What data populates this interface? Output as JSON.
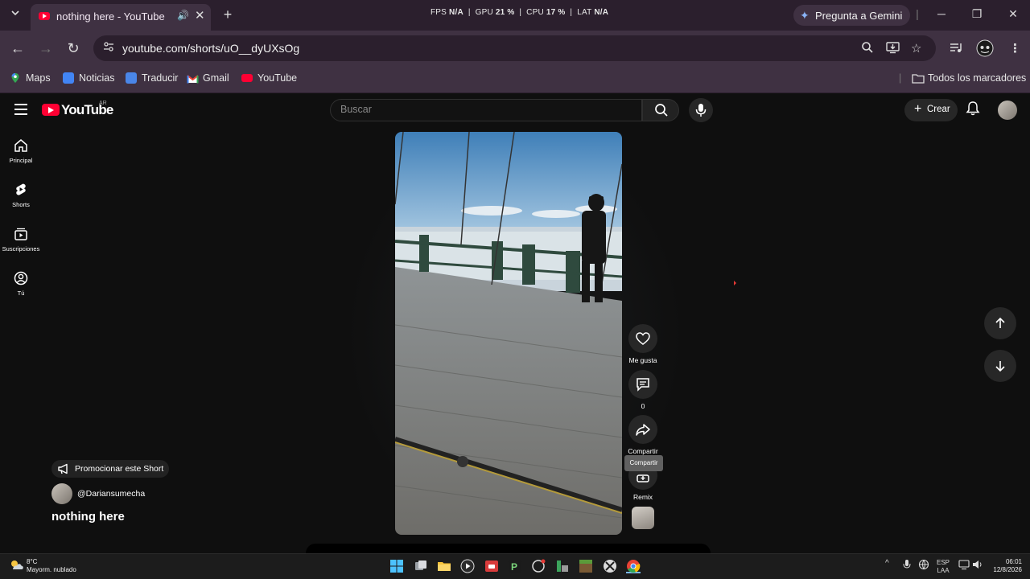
{
  "browser": {
    "tab": {
      "title": "nothing here - YouTube"
    },
    "perf": {
      "fps_label": "FPS",
      "fps": "N/A",
      "gpu_label": "GPU",
      "gpu": "21 %",
      "cpu_label": "CPU",
      "cpu": "17 %",
      "lat_label": "LAT",
      "lat": "N/A"
    },
    "gemini_label": "Pregunta a Gemini",
    "url": "youtube.com/shorts/uO__dyUXsOg",
    "bookmarks": [
      "Maps",
      "Noticias",
      "Traducir",
      "Gmail",
      "YouTube"
    ],
    "all_bookmarks_label": "Todos los marcadores"
  },
  "youtube": {
    "logo_text": "YouTube",
    "country_code": "AR",
    "search_placeholder": "Buscar",
    "create_label": "Crear",
    "rail": [
      {
        "label": "Principal",
        "icon": "home-icon"
      },
      {
        "label": "Shorts",
        "icon": "shorts-icon"
      },
      {
        "label": "Suscripciones",
        "icon": "subscriptions-icon"
      },
      {
        "label": "Tú",
        "icon": "you-icon"
      }
    ],
    "actions": {
      "like_label": "Me gusta",
      "comments_count": "0",
      "share_label": "Compartir",
      "share_tooltip": "Compartir",
      "remix_label": "Remix"
    },
    "promote_label": "Promocionar este Short",
    "channel": "@Dariansumecha",
    "title": "nothing here"
  },
  "taskbar": {
    "weather_temp": "8°C",
    "weather_desc": "Mayorm. nublado",
    "lang_line1": "ESP",
    "lang_line2": "LAA",
    "time": "06:01",
    "date": "12/8/2026"
  },
  "colors": {
    "browser_frame": "#3f3142",
    "tab_strip": "#2b1f2d",
    "yt_background": "#0f0f0f",
    "yt_red": "#ff0033",
    "button_bg": "#272727"
  }
}
